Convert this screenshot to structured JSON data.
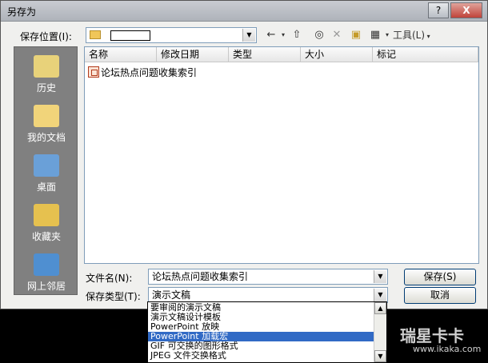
{
  "window": {
    "title": "另存为",
    "help_label": "?",
    "close_label": "X"
  },
  "lookin": {
    "label": "保存位置(I):",
    "value": ""
  },
  "toolbar": {
    "tools_label": "工具(L)"
  },
  "places": [
    {
      "label": "历史",
      "icon": "history-icon",
      "color": "#e8d27a"
    },
    {
      "label": "我的文档",
      "icon": "my-documents-icon",
      "color": "#f1d47a"
    },
    {
      "label": "桌面",
      "icon": "desktop-icon",
      "color": "#6aa0d8"
    },
    {
      "label": "收藏夹",
      "icon": "favorites-icon",
      "color": "#e6c14f"
    },
    {
      "label": "网上邻居",
      "icon": "network-icon",
      "color": "#4f8fd1"
    }
  ],
  "columns": [
    "名称",
    "修改日期",
    "类型",
    "大小",
    "标记"
  ],
  "files": [
    {
      "name": "论坛热点问题收集索引",
      "icon": "powerpoint-file-icon"
    }
  ],
  "filename": {
    "label": "文件名(N):",
    "value": "论坛热点问题收集索引"
  },
  "filetype": {
    "label": "保存类型(T):",
    "value": "演示文稿",
    "options": [
      "要审阅的演示文稿",
      "演示文稿设计模板",
      "PowerPoint 放映",
      "PowerPoint 加载宏",
      "GIF 可交换的图形格式",
      "JPEG 文件交换格式"
    ],
    "selected_index": 3
  },
  "buttons": {
    "save": "保存(S)",
    "cancel": "取消"
  },
  "watermark": {
    "title": "瑞星卡卡",
    "url": "www.ikaka.com"
  }
}
